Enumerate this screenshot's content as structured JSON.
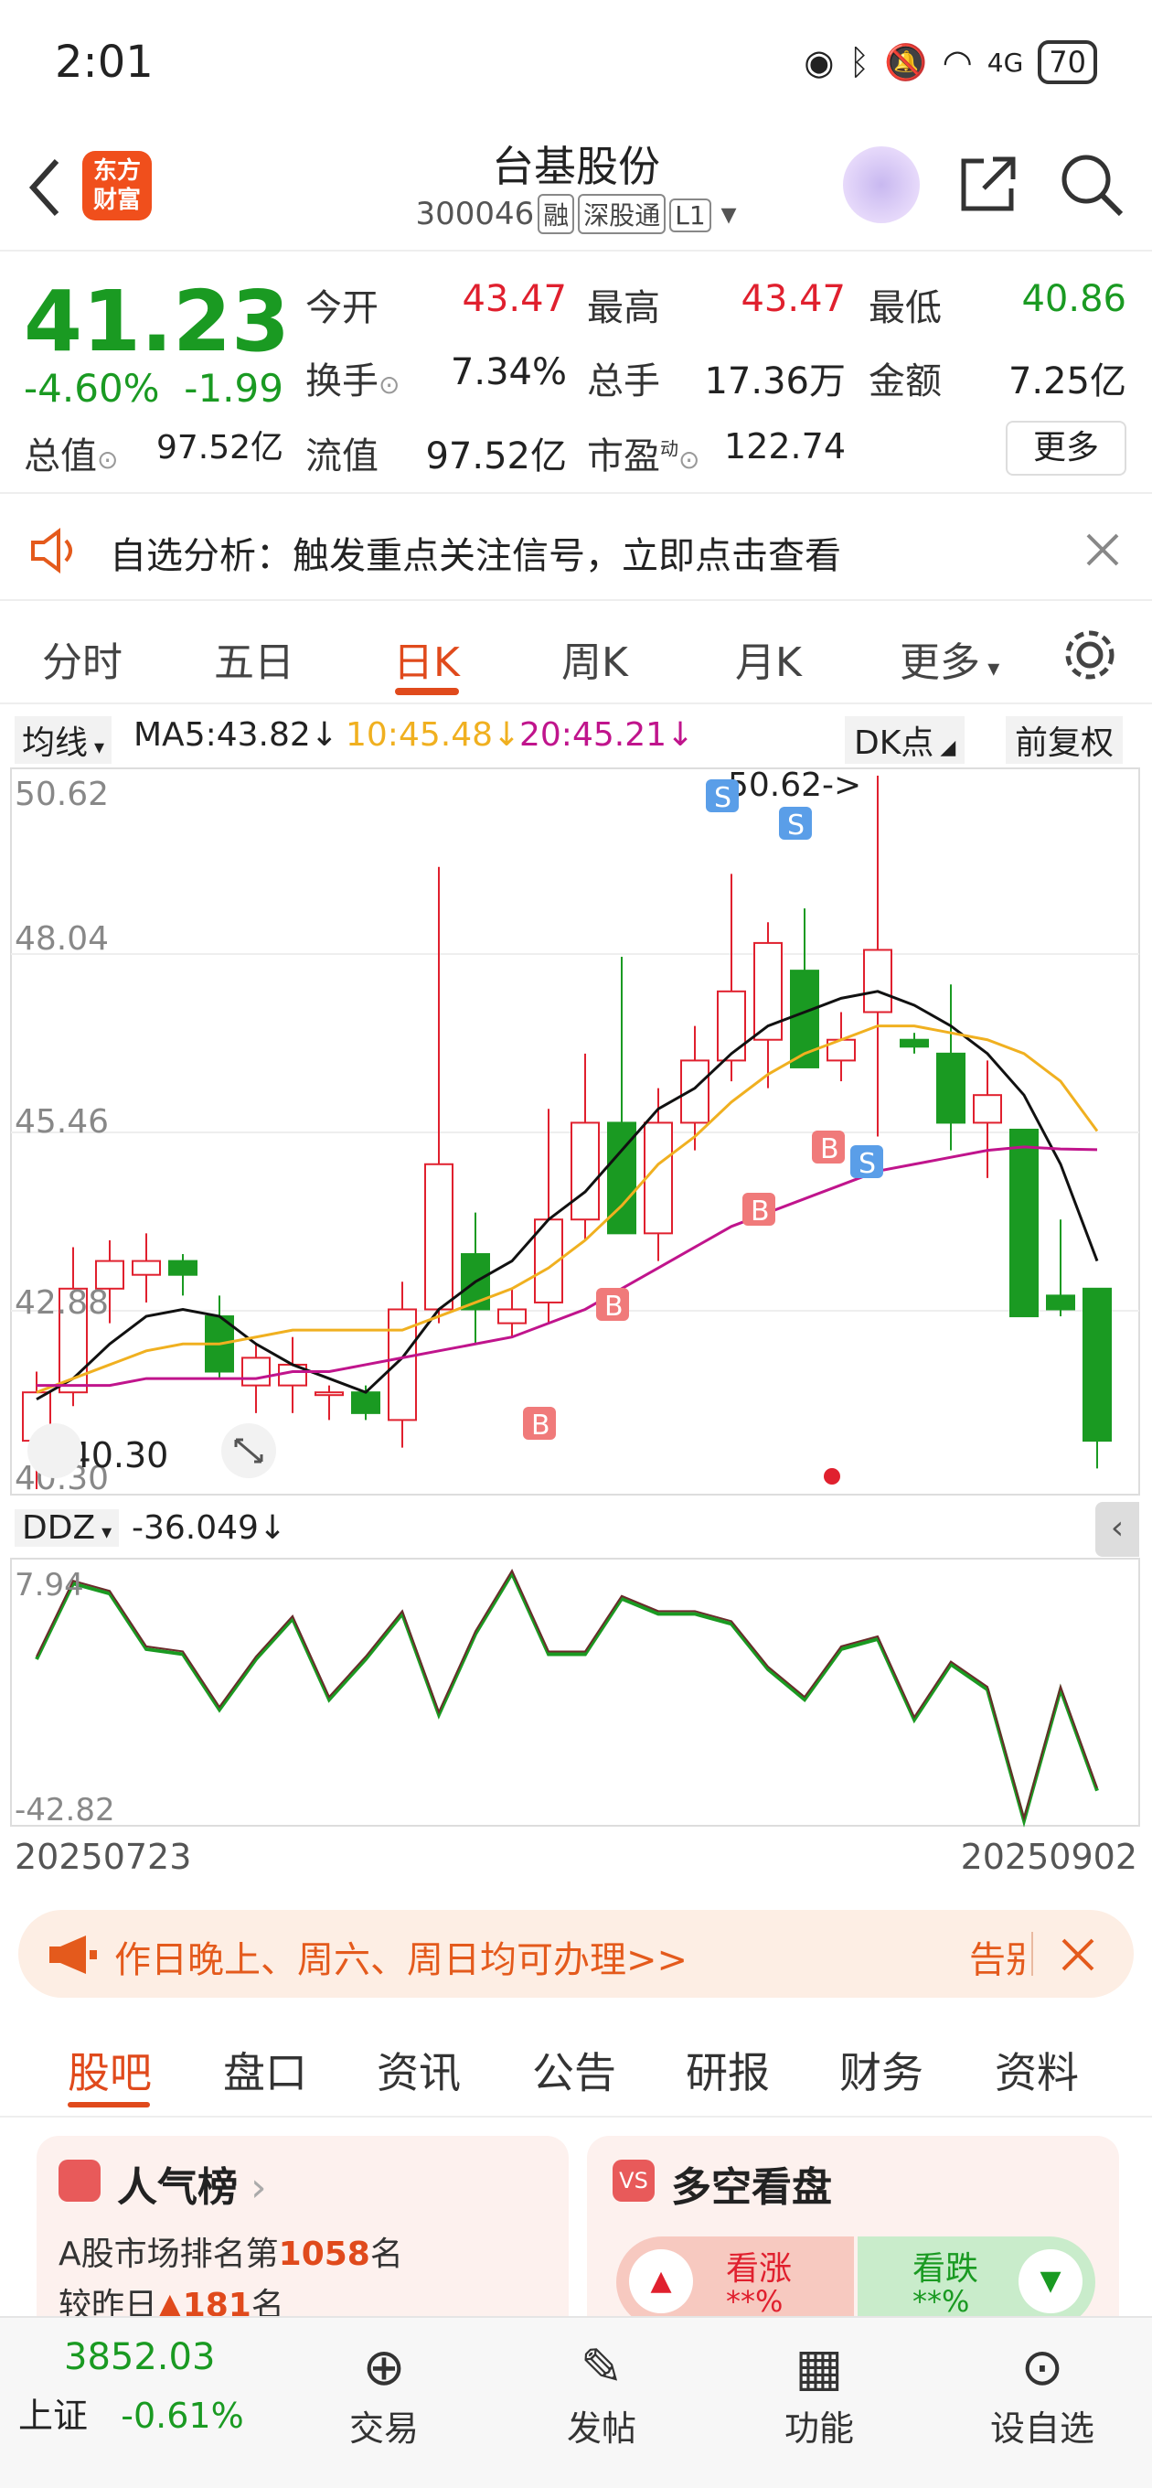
{
  "status": {
    "time": "2:01",
    "battery": "70",
    "network": "4G"
  },
  "header": {
    "logo_line1": "东方",
    "logo_line2": "财富",
    "title": "台基股份",
    "code": "300046",
    "tags": [
      "融",
      "深股通",
      "L1"
    ]
  },
  "quote": {
    "price": "41.23",
    "change_pct": "-4.60%",
    "change": "-1.99",
    "rows": [
      {
        "l1": "今开",
        "v1": "43.47",
        "l2": "最高",
        "v2": "43.47",
        "l3": "最低",
        "v3": "40.86"
      },
      {
        "l1": "换手",
        "v1": "7.34%",
        "l2": "总手",
        "v2": "17.36万",
        "l3": "金额",
        "v3": "7.25亿"
      },
      {
        "l1": "总值",
        "v1": "97.52亿",
        "l2": "流值",
        "v2": "97.52亿",
        "l3": "市盈",
        "sup": "动",
        "v3": "122.74"
      }
    ],
    "more": "更多"
  },
  "notice": {
    "text": "自选分析：触发重点关注信号，立即点击查看"
  },
  "tabs": [
    "分时",
    "五日",
    "日K",
    "周K",
    "月K",
    "更多"
  ],
  "ma": {
    "selector": "均线",
    "ma5": "MA5:43.82",
    "ma10": "10:45.48",
    "ma20": "20:45.21",
    "dk": "DK点",
    "adj": "前复权"
  },
  "chart_labels": {
    "y_ticks": [
      "50.62",
      "48.04",
      "45.46",
      "42.88",
      "40.30"
    ],
    "max_label": "50.62->",
    "min_label": "<-40.30",
    "buy": "B",
    "sell": "S"
  },
  "ddz": {
    "selector": "DDZ",
    "value": "-36.049",
    "y_max": "7.94",
    "y_min": "-42.82",
    "date_start": "20250723",
    "date_end": "20250902"
  },
  "banner": {
    "text": "作日晚上、周六、周日均可办理>>",
    "tail": "告别"
  },
  "subtabs": [
    "股吧",
    "盘口",
    "资讯",
    "公告",
    "研报",
    "财务",
    "资料"
  ],
  "cards": {
    "left_title": "人气榜",
    "left_line1": "A股市场排名第",
    "rank": "1058",
    "rank_suffix": "名",
    "left_line2": "较昨日",
    "delta": "181",
    "delta_suffix": "名",
    "right_title": "多空看盘",
    "bull": "看涨",
    "bear": "看跌",
    "bull_pct": "**%",
    "bear_pct": "**%"
  },
  "bottom": {
    "index_value": "3852.03",
    "index_name": "上证",
    "index_change": "-0.61%",
    "nav": [
      "交易",
      "发帖",
      "功能",
      "设自选"
    ]
  },
  "colors": {
    "up": "#e0202e",
    "down": "#1a9a22",
    "accent": "#e04a1c",
    "ma5": "#111111",
    "ma10": "#f0b020",
    "ma20": "#c0148c"
  },
  "chart_data": {
    "type": "candlestick",
    "ylim": [
      40.3,
      50.62
    ],
    "candles": [
      {
        "o": 41.0,
        "h": 42.0,
        "l": 40.3,
        "c": 41.7
      },
      {
        "o": 41.7,
        "h": 43.8,
        "l": 41.5,
        "c": 43.2
      },
      {
        "o": 43.2,
        "h": 43.9,
        "l": 42.7,
        "c": 43.6
      },
      {
        "o": 43.4,
        "h": 44.0,
        "l": 43.0,
        "c": 43.6
      },
      {
        "o": 43.6,
        "h": 43.7,
        "l": 43.1,
        "c": 43.4
      },
      {
        "o": 42.8,
        "h": 43.1,
        "l": 41.9,
        "c": 42.0
      },
      {
        "o": 41.8,
        "h": 42.4,
        "l": 41.4,
        "c": 42.2
      },
      {
        "o": 41.8,
        "h": 42.5,
        "l": 41.4,
        "c": 42.1
      },
      {
        "o": 41.7,
        "h": 41.8,
        "l": 41.3,
        "c": 41.7
      },
      {
        "o": 41.7,
        "h": 41.8,
        "l": 41.3,
        "c": 41.4
      },
      {
        "o": 41.3,
        "h": 43.3,
        "l": 40.9,
        "c": 42.9
      },
      {
        "o": 42.9,
        "h": 49.3,
        "l": 42.7,
        "c": 45.0
      },
      {
        "o": 43.7,
        "h": 44.3,
        "l": 42.4,
        "c": 42.9
      },
      {
        "o": 42.7,
        "h": 43.2,
        "l": 42.5,
        "c": 42.9
      },
      {
        "o": 43.0,
        "h": 45.8,
        "l": 42.7,
        "c": 44.2
      },
      {
        "o": 44.2,
        "h": 46.6,
        "l": 43.9,
        "c": 45.6
      },
      {
        "o": 45.6,
        "h": 48.0,
        "l": 44.0,
        "c": 44.0
      },
      {
        "o": 44.0,
        "h": 46.1,
        "l": 43.6,
        "c": 45.6
      },
      {
        "o": 45.6,
        "h": 47.0,
        "l": 45.2,
        "c": 46.5
      },
      {
        "o": 46.5,
        "h": 49.2,
        "l": 46.2,
        "c": 47.5
      },
      {
        "o": 46.8,
        "h": 48.5,
        "l": 46.1,
        "c": 48.2
      },
      {
        "o": 47.8,
        "h": 48.7,
        "l": 46.4,
        "c": 46.4
      },
      {
        "o": 46.5,
        "h": 47.2,
        "l": 46.2,
        "c": 46.8
      },
      {
        "o": 47.2,
        "h": 50.62,
        "l": 45.4,
        "c": 48.1
      },
      {
        "o": 46.8,
        "h": 46.9,
        "l": 46.6,
        "c": 46.7
      },
      {
        "o": 46.6,
        "h": 47.6,
        "l": 45.2,
        "c": 45.6
      },
      {
        "o": 45.6,
        "h": 46.5,
        "l": 44.8,
        "c": 46.0
      },
      {
        "o": 45.5,
        "h": 45.5,
        "l": 42.8,
        "c": 42.8
      },
      {
        "o": 43.1,
        "h": 44.2,
        "l": 42.8,
        "c": 42.9
      },
      {
        "o": 43.2,
        "h": 43.2,
        "l": 40.6,
        "c": 41.0
      }
    ],
    "ma5": [
      41.6,
      41.9,
      42.4,
      42.8,
      42.9,
      42.8,
      42.4,
      42.1,
      41.9,
      41.7,
      42.2,
      42.9,
      43.3,
      43.6,
      44.2,
      44.6,
      45.2,
      45.8,
      46.1,
      46.6,
      47.0,
      47.2,
      47.4,
      47.5,
      47.3,
      47.0,
      46.6,
      46.0,
      45.0,
      43.6
    ],
    "ma10": [
      41.7,
      41.9,
      42.1,
      42.3,
      42.4,
      42.4,
      42.5,
      42.6,
      42.6,
      42.6,
      42.6,
      42.8,
      43.0,
      43.2,
      43.5,
      43.9,
      44.4,
      45.0,
      45.4,
      45.9,
      46.3,
      46.6,
      46.8,
      47.0,
      47.0,
      46.9,
      46.8,
      46.6,
      46.2,
      45.48
    ],
    "ma20": [
      41.8,
      41.8,
      41.8,
      41.9,
      41.9,
      41.9,
      41.9,
      42.0,
      42.0,
      42.1,
      42.2,
      42.3,
      42.4,
      42.5,
      42.7,
      42.9,
      43.2,
      43.5,
      43.8,
      44.1,
      44.3,
      44.5,
      44.7,
      44.9,
      45.0,
      45.1,
      45.2,
      45.25,
      45.22,
      45.21
    ],
    "ddz": [
      -10,
      5,
      3,
      -8,
      -9,
      -20,
      -10,
      -2,
      -18,
      -10,
      -1,
      -21,
      -5,
      7,
      -9,
      -9,
      2,
      -1,
      -1,
      -3,
      -12,
      -18,
      -8,
      -6,
      -22,
      -11,
      -16,
      -42,
      -16,
      -36.049
    ],
    "ddz_ylim": [
      -42.82,
      7.94
    ]
  }
}
